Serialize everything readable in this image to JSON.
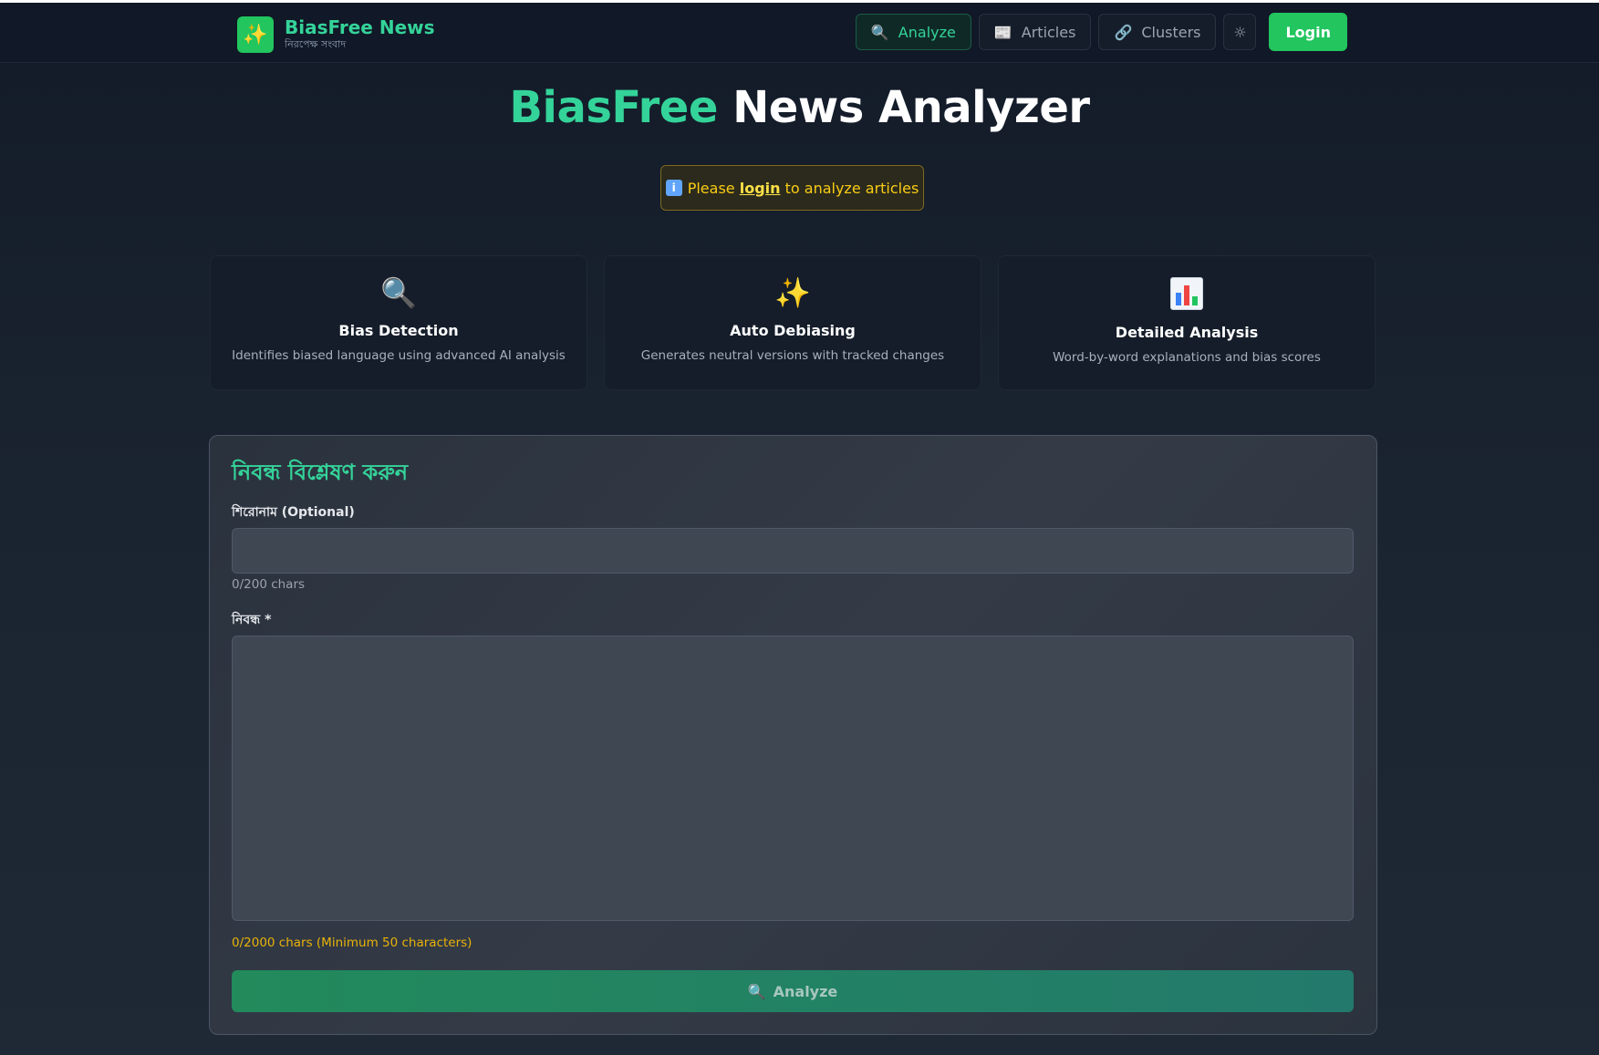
{
  "brand": {
    "logo_icon": "sparkles-icon",
    "title": "BiasFree News",
    "subtitle": "নিরপেক্ষ সংবাদ"
  },
  "nav": {
    "items": [
      {
        "label": "Analyze",
        "icon": "magnifier-icon",
        "active": true
      },
      {
        "label": "Articles",
        "icon": "newspaper-icon",
        "active": false
      },
      {
        "label": "Clusters",
        "icon": "link-icon",
        "active": false
      }
    ],
    "theme_toggle_icon": "sun-icon",
    "login_label": "Login"
  },
  "hero": {
    "title_accent": "BiasFree",
    "title_rest": " News Analyzer"
  },
  "notice": {
    "icon": "info-icon",
    "prefix": "Please ",
    "link": "login",
    "suffix": " to analyze articles"
  },
  "features": [
    {
      "icon": "magnifier-icon",
      "title": "Bias Detection",
      "description": "Identifies biased language using advanced AI analysis"
    },
    {
      "icon": "sparkles-icon",
      "title": "Auto Debiasing",
      "description": "Generates neutral versions with tracked changes"
    },
    {
      "icon": "bar-chart-icon",
      "title": "Detailed Analysis",
      "description": "Word-by-word explanations and bias scores"
    }
  ],
  "form": {
    "title": "নিবন্ধ বিশ্লেষণ করুন",
    "headline_label": "শিরোনাম (Optional)",
    "headline_value": "",
    "headline_counter": "0/200 chars",
    "article_label": "নিবন্ধ *",
    "article_value": "",
    "article_counter": "0/2000 chars (Minimum 50 characters)",
    "submit_label": "Analyze",
    "submit_icon": "magnifier-icon"
  },
  "colors": {
    "accent": "#34d399",
    "brand_green": "#22c55e",
    "warning": "#facc15",
    "background": "#1a2330"
  }
}
